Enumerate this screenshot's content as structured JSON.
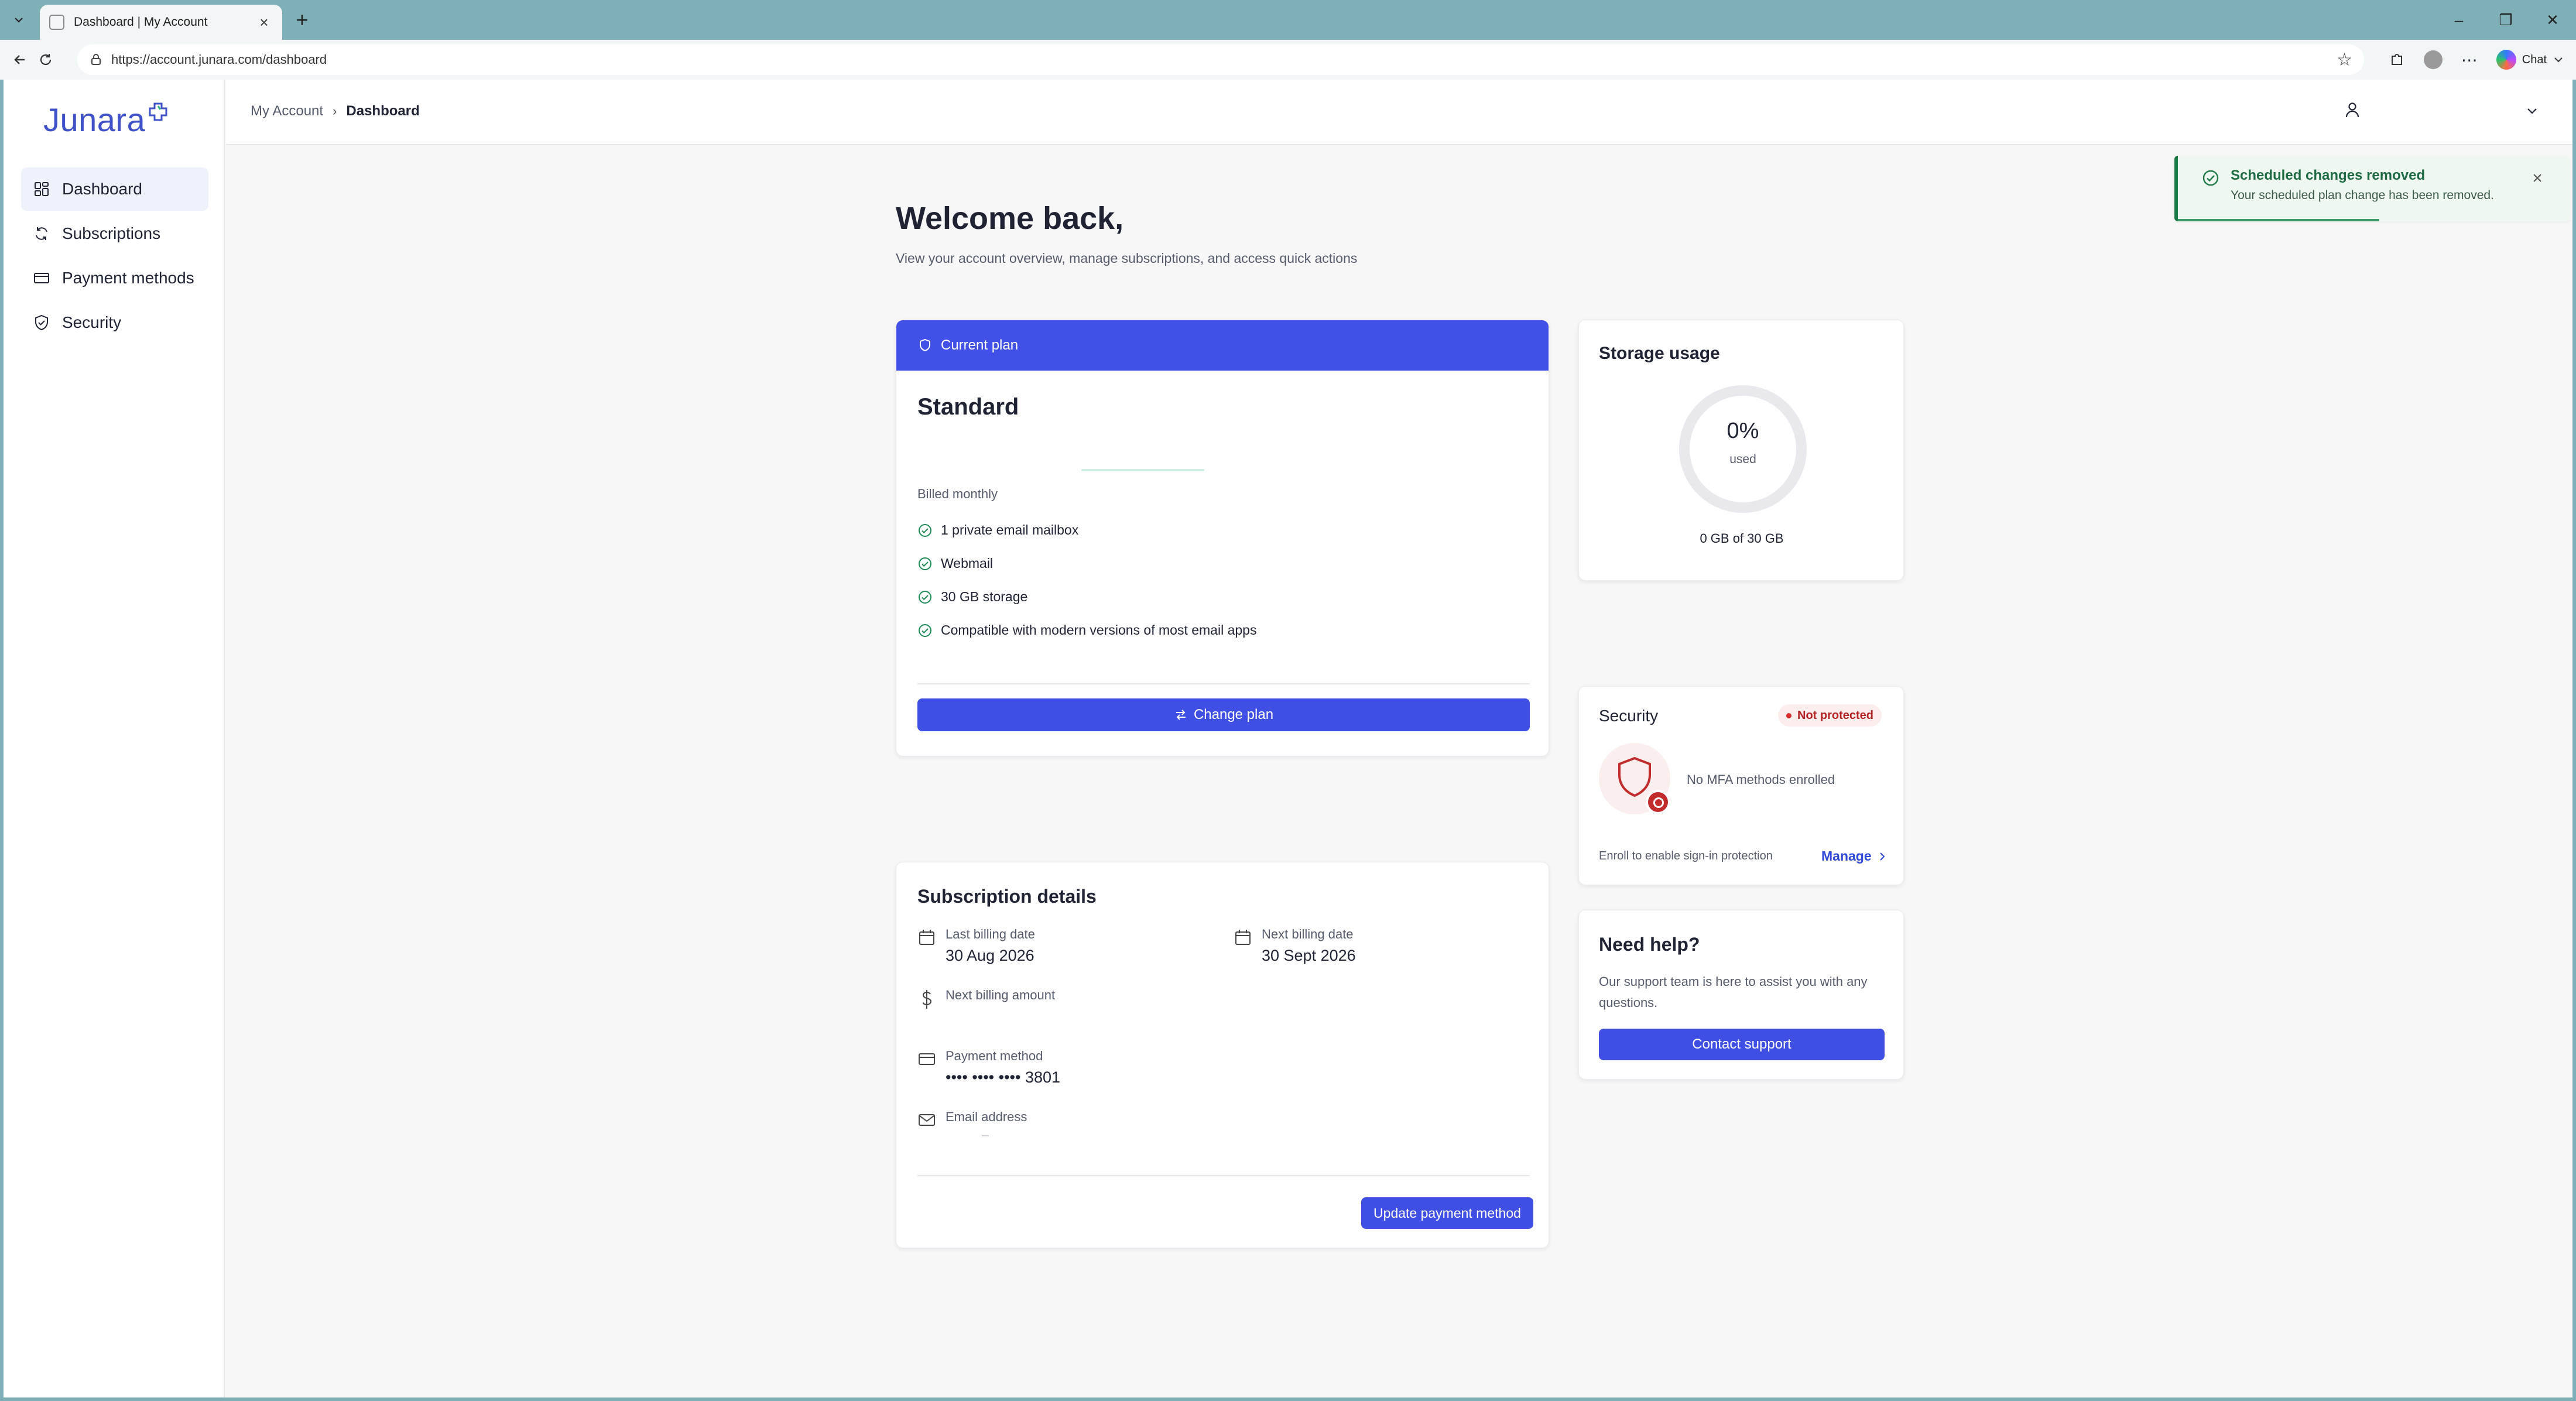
{
  "browser": {
    "tab_title": "Dashboard | My Account",
    "url": "https://account.junara.com/dashboard",
    "chat_label": "Chat"
  },
  "app": {
    "logo": "Junara",
    "brand_color": "#4052c8",
    "accent_color": "#3f4fe4"
  },
  "sidebar": {
    "items": [
      {
        "label": "Dashboard",
        "icon": "dashboard-icon",
        "active": true
      },
      {
        "label": "Subscriptions",
        "icon": "refresh-icon",
        "active": false
      },
      {
        "label": "Payment methods",
        "icon": "credit-card-icon",
        "active": false
      },
      {
        "label": "Security",
        "icon": "shield-check-icon",
        "active": false
      }
    ]
  },
  "breadcrumb": {
    "parent": "My Account",
    "current": "Dashboard"
  },
  "header": {
    "title": "Welcome back,",
    "subtitle": "View your account overview, manage subscriptions, and access quick actions"
  },
  "plan": {
    "header_label": "Current plan",
    "name": "Standard",
    "billing": "Billed monthly",
    "features": [
      "1 private email mailbox",
      "Webmail",
      "30 GB storage",
      "Compatible with modern versions of most email apps"
    ],
    "change_button": "Change plan"
  },
  "subscription": {
    "title": "Subscription details",
    "last_billing_label": "Last billing date",
    "last_billing_value": "30 Aug 2026",
    "next_billing_label": "Next billing date",
    "next_billing_value": "30 Sept 2026",
    "amount_label": "Next billing amount",
    "payment_label": "Payment method",
    "payment_value": "•••• •••• •••• 3801",
    "email_label": "Email address",
    "update_button": "Update payment method"
  },
  "storage": {
    "title": "Storage usage",
    "percent": "0%",
    "used_label": "used",
    "used_fraction": 0,
    "summary": "0 GB of 30 GB"
  },
  "security": {
    "title": "Security",
    "status": "Not protected",
    "status_color": "#d92b2b",
    "mfa_text": "No MFA methods enrolled",
    "enroll_text": "Enroll to enable sign-in protection",
    "manage_link": "Manage"
  },
  "help": {
    "title": "Need help?",
    "text": "Our support team is here to assist you with any questions.",
    "button": "Contact support"
  },
  "toast": {
    "title": "Scheduled changes removed",
    "message": "Your scheduled plan change has been removed.",
    "color": "#1f7a4a"
  }
}
